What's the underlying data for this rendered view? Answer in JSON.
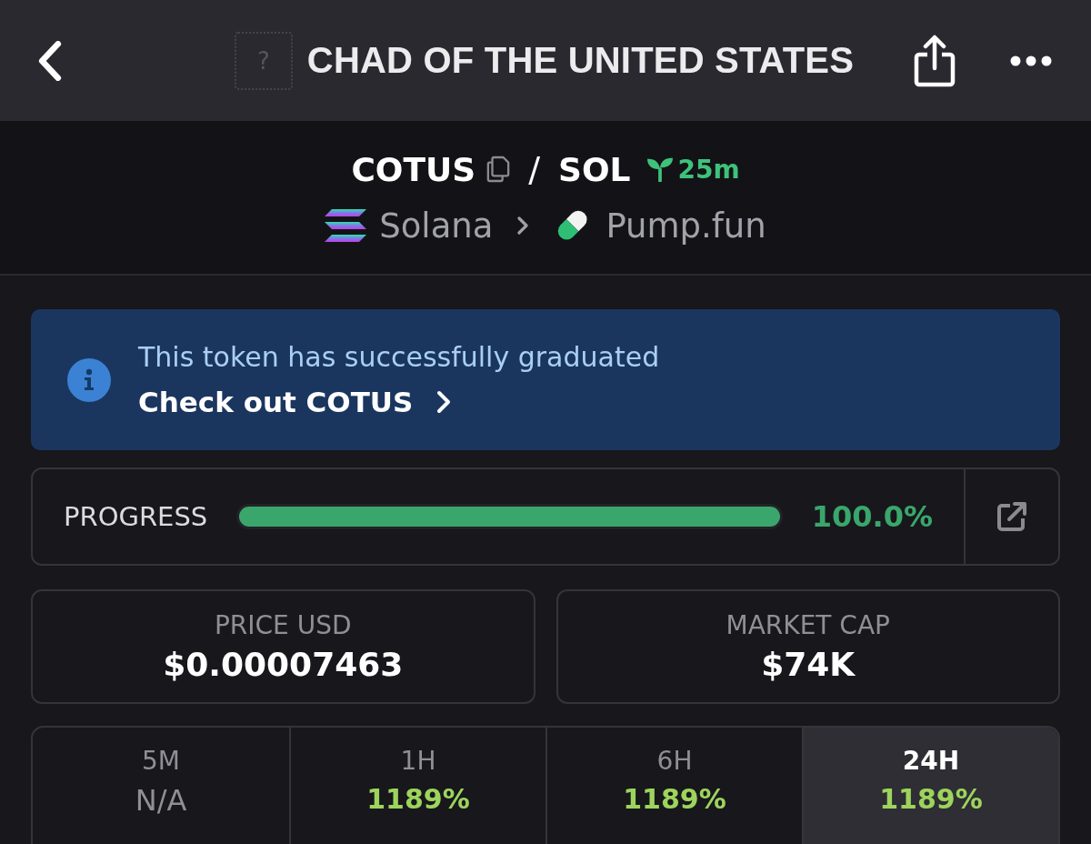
{
  "header": {
    "title": "CHAD OF THE UNITED STATES",
    "token_image_glyph": "?"
  },
  "pair": {
    "base": "COTUS",
    "separator": "/",
    "quote": "SOL",
    "age": "25m",
    "chain": "Solana",
    "dex": "Pump.fun"
  },
  "banner": {
    "message": "This token has successfully graduated",
    "link": "Check out COTUS"
  },
  "progress": {
    "label": "PROGRESS",
    "level": 1.0,
    "reading": "100.0%"
  },
  "stats": [
    {
      "label": "PRICE USD",
      "value": "$0.00007463"
    },
    {
      "label": "MARKET CAP",
      "value": "$74K"
    }
  ],
  "timeframes": [
    {
      "label": "5M",
      "value": "N/A",
      "kind": "none",
      "selected": false
    },
    {
      "label": "1H",
      "value": "1189%",
      "kind": "gain",
      "selected": false
    },
    {
      "label": "6H",
      "value": "1189%",
      "kind": "gain",
      "selected": false
    },
    {
      "label": "24H",
      "value": "1189%",
      "kind": "gain",
      "selected": true
    }
  ]
}
